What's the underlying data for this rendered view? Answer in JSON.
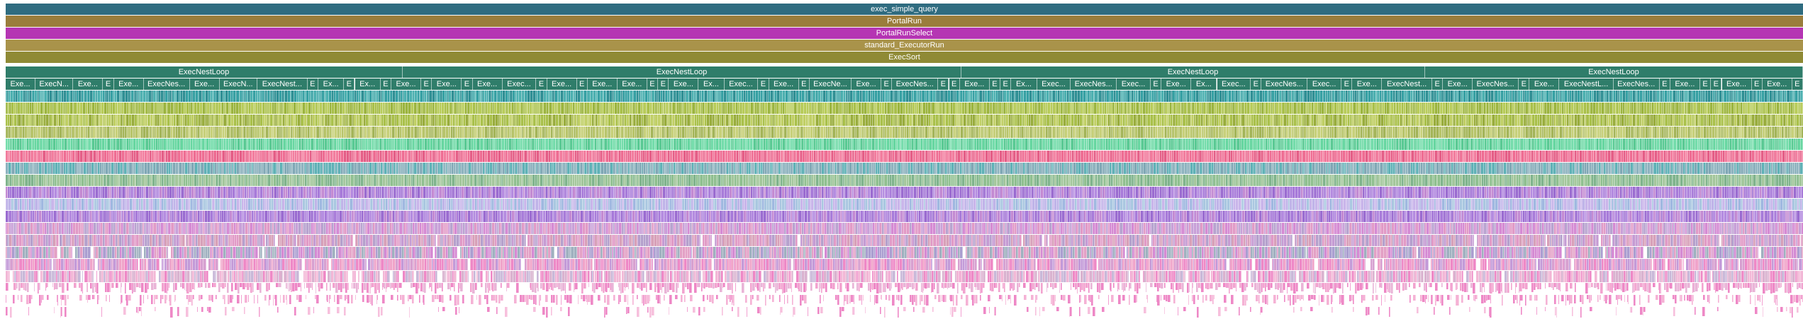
{
  "palette": {
    "teal": "#2f6c80",
    "olive": "#9a7d3c",
    "magenta": "#b535b3",
    "olive2": "#a9934a",
    "green": "#8f8a35",
    "sea": "#2f7d6a",
    "cyan": "#36a0a3",
    "lime": "#a9c04a",
    "mint": "#66d6a0",
    "rose": "#ee6c92",
    "steel": "#7fa7b5",
    "violet": "#a77ad9",
    "lavender": "#bfb4e8",
    "orchid": "#d58ad3",
    "pink": "#ee88c6"
  },
  "frames": {
    "exec_simple_query": "exec_simple_query",
    "portal_run": "PortalRun",
    "portal_run_select": "PortalRunSelect",
    "standard_executor_run": "standard_ExecutorRun",
    "exec_sort": "ExecSort"
  },
  "nest_loops": [
    {
      "label": "ExecNestLoop"
    },
    {
      "label": "ExecNestLoop"
    },
    {
      "label": "ExecNestLoop"
    },
    {
      "label": "ExecNestLoop"
    }
  ],
  "children_labels": [
    "Exe...",
    "ExecN...",
    "Exe...",
    "E",
    "Exe...",
    "ExecNes...",
    "Exe...",
    "ExecN...",
    "ExecNest...",
    "E",
    "Ex...",
    "E",
    "Ex...",
    "E",
    "Exe...",
    "E",
    "Exe...",
    "E",
    "Exe...",
    "Exec...",
    "E",
    "Exe...",
    "E",
    "Exe...",
    "Exe...",
    "E",
    "E",
    "Exe...",
    "Ex...",
    "Exec...",
    "E",
    "Exe...",
    "E",
    "ExecNe...",
    "Exe...",
    "E",
    "ExecNes...",
    "E",
    "E",
    "Exe...",
    "E",
    "E",
    "Ex...",
    "Exec...",
    "ExecNes...",
    "Exec...",
    "E",
    "Exe...",
    "Ex...",
    "Exec...",
    "E",
    "ExecNes...",
    "Exec...",
    "E",
    "Exe...",
    "ExecNest...",
    "E",
    "Exe...",
    "ExecNes...",
    "E",
    "Exe...",
    "ExecNestL...",
    "ExecNes...",
    "E",
    "Exe...",
    "E",
    "E",
    "Exe...",
    "E",
    "Exe...",
    "E"
  ]
}
